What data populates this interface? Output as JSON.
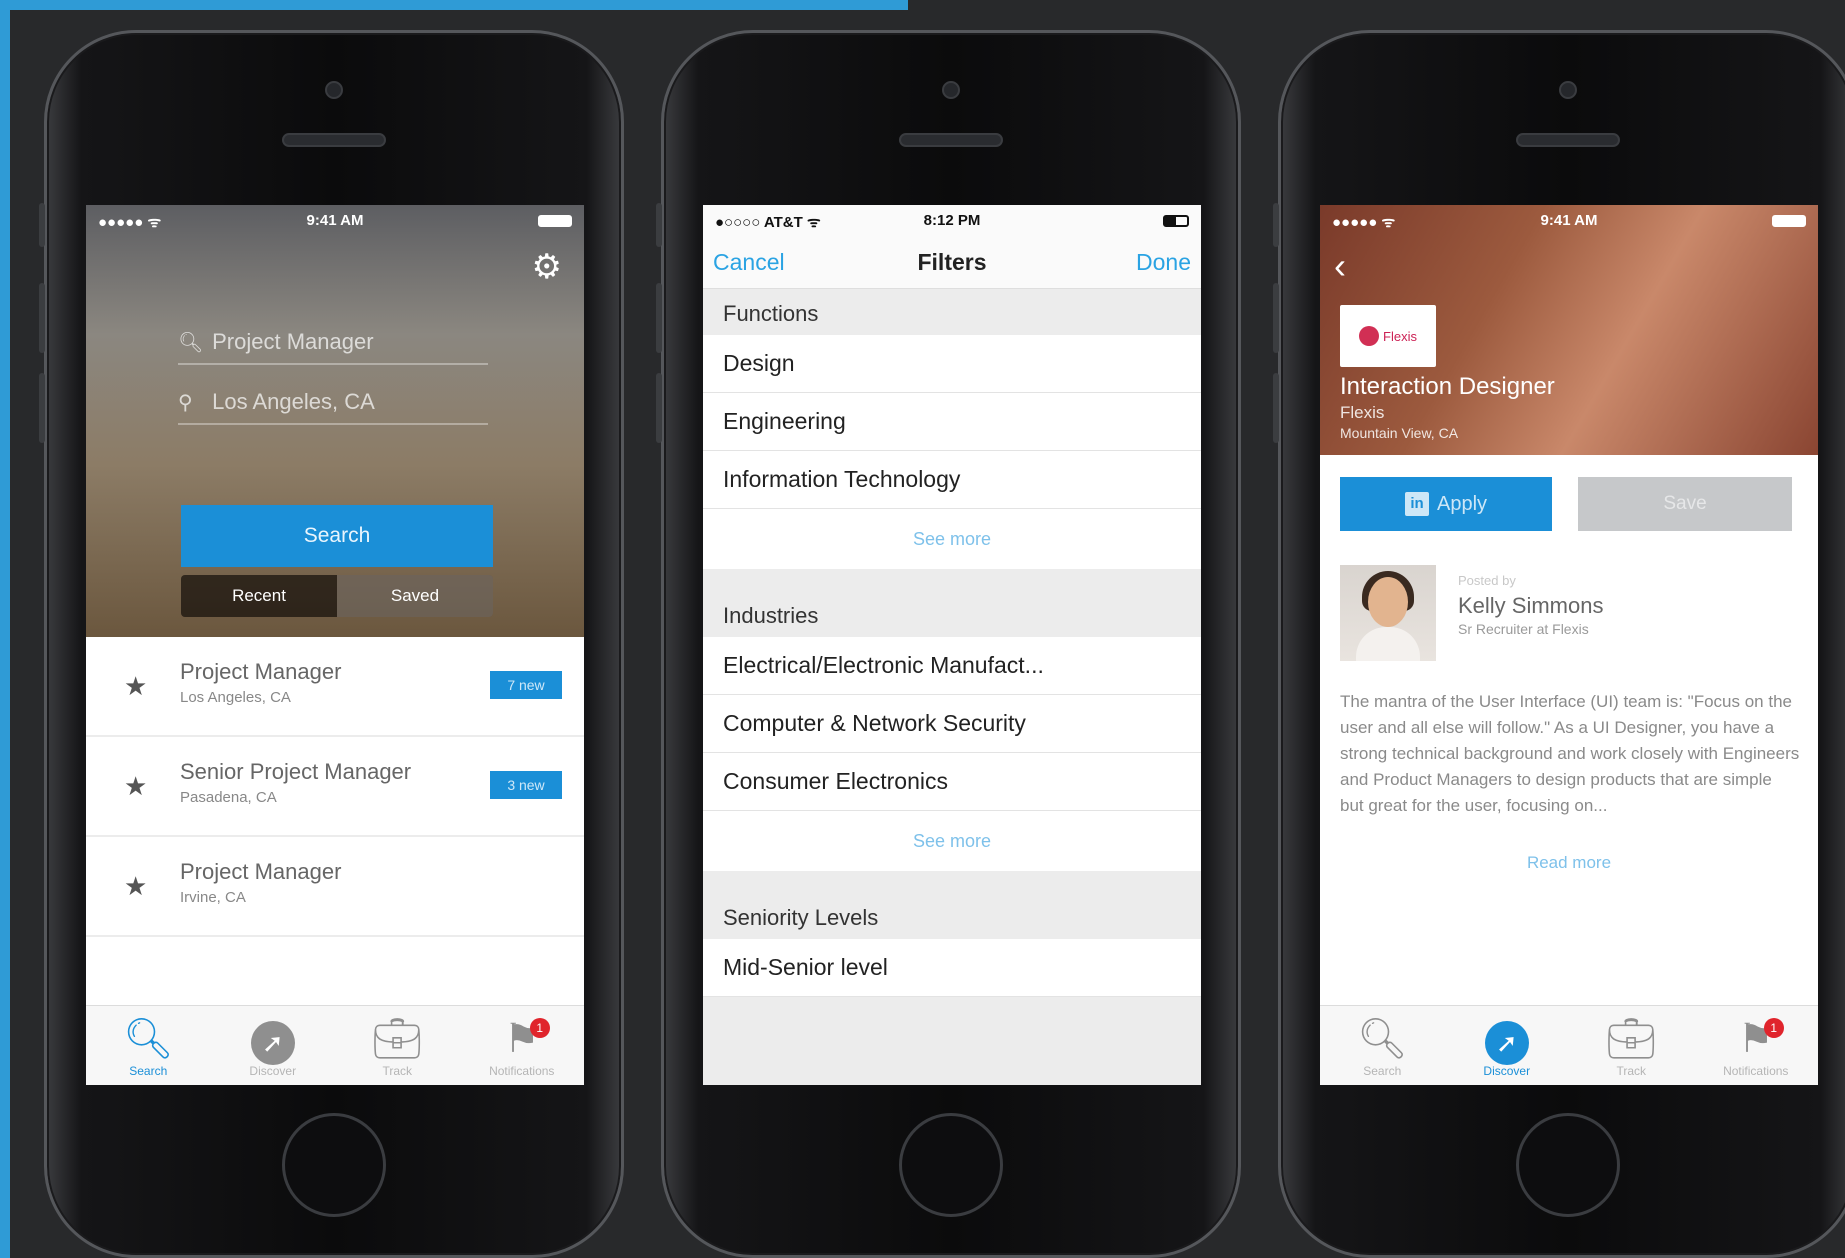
{
  "phone1": {
    "status": {
      "signal": "●●●●● ᯤ",
      "time": "9:41 AM"
    },
    "search": {
      "keyword": "Project Manager",
      "location": "Los Angeles, CA",
      "button": "Search"
    },
    "segments": [
      "Recent",
      "Saved"
    ],
    "saved": [
      {
        "title": "Project Manager",
        "location": "Los Angeles, CA",
        "badge": "7 new"
      },
      {
        "title": "Senior Project Manager",
        "location": "Pasadena, CA",
        "badge": "3 new"
      },
      {
        "title": "Project Manager",
        "location": "Irvine, CA",
        "badge": ""
      }
    ],
    "tabs": [
      {
        "label": "Search",
        "icon": "search-icon",
        "active": true
      },
      {
        "label": "Discover",
        "icon": "compass-icon",
        "active": false
      },
      {
        "label": "Track",
        "icon": "briefcase-icon",
        "active": false
      },
      {
        "label": "Notifications",
        "icon": "flag-icon",
        "active": false,
        "badge": "1"
      }
    ]
  },
  "phone2": {
    "status": {
      "signal": "●○○○○ AT&T ᯤ",
      "time": "8:12 PM"
    },
    "nav": {
      "cancel": "Cancel",
      "title": "Filters",
      "done": "Done"
    },
    "sections": [
      {
        "header": "Functions",
        "items": [
          "Design",
          "Engineering",
          "Information Technology"
        ],
        "more": "See more"
      },
      {
        "header": "Industries",
        "items": [
          "Electrical/Electronic Manufact...",
          "Computer & Network Security",
          "Consumer Electronics"
        ],
        "more": "See more"
      },
      {
        "header": "Seniority Levels",
        "items": [
          "Mid-Senior level"
        ],
        "more": ""
      }
    ]
  },
  "phone3": {
    "status": {
      "signal": "●●●●● ᯤ",
      "time": "9:41 AM"
    },
    "job": {
      "logo_text": "Flexis",
      "title": "Interaction Designer",
      "company": "Flexis",
      "location": "Mountain View, CA"
    },
    "actions": {
      "apply": "Apply",
      "save": "Save"
    },
    "poster": {
      "posted_by": "Posted by",
      "name": "Kelly Simmons",
      "role": "Sr Recruiter at Flexis"
    },
    "description": "The mantra of the User Interface (UI) team is: \"Focus on the user and all else will follow.\" As a UI Designer, you have a strong technical background and work closely with Engineers and Product Managers to design products that are simple but great for the user, focusing on...",
    "read_more": "Read more",
    "tabs": [
      {
        "label": "Search",
        "icon": "search-icon",
        "active": false
      },
      {
        "label": "Discover",
        "icon": "compass-icon",
        "active": true
      },
      {
        "label": "Track",
        "icon": "briefcase-icon",
        "active": false
      },
      {
        "label": "Notifications",
        "icon": "flag-icon",
        "active": false,
        "badge": "1"
      }
    ]
  },
  "colors": {
    "accent": "#1b8fd7",
    "background": "#28292b",
    "link": "#2aa3e3"
  }
}
